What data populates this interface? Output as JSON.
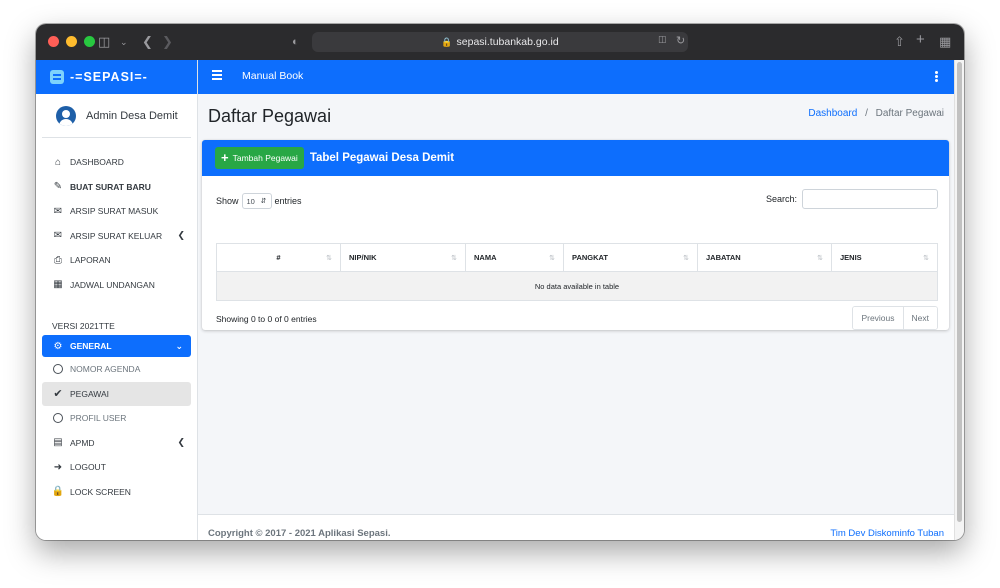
{
  "browser": {
    "url": "sepasi.tubankab.go.id"
  },
  "sidebar": {
    "brand": "-=SEPASI=-",
    "user": "Admin Desa Demit",
    "items": [
      {
        "label": "DASHBOARD",
        "icon": "home-icon",
        "bold": false
      },
      {
        "label": "BUAT SURAT BARU",
        "icon": "edit-icon",
        "bold": true
      },
      {
        "label": "ARSIP SURAT MASUK",
        "icon": "inbox-icon",
        "bold": false
      },
      {
        "label": "ARSIP SURAT KELUAR",
        "icon": "outbox-icon",
        "bold": false
      },
      {
        "label": "LAPORAN",
        "icon": "printer-icon",
        "bold": false
      },
      {
        "label": "JADWAL UNDANGAN",
        "icon": "calendar-icon",
        "bold": false
      }
    ],
    "version_header": "VERSI 2021TTE",
    "general": "GENERAL",
    "sub_items": [
      {
        "label": "NOMOR AGENDA"
      },
      {
        "label": "PEGAWAI"
      },
      {
        "label": "PROFIL USER"
      }
    ],
    "apmd": "APMD",
    "logout": "LOGOUT",
    "lock": "LOCK SCREEN"
  },
  "navbar": {
    "link": "Manual Book"
  },
  "header": {
    "title": "Daftar Pegawai",
    "breadcrumb_home": "Dashboard",
    "breadcrumb_sep": "/",
    "breadcrumb_current": "Daftar Pegawai"
  },
  "card": {
    "add_button": "Tambah Pegawai",
    "title": "Tabel Pegawai Desa Demit"
  },
  "datatable": {
    "show_label": "Show",
    "length_value": "10",
    "entries_label": "entries",
    "search_label": "Search:",
    "search_value": "",
    "columns": [
      "#",
      "NIP/NIK",
      "NAMA",
      "PANGKAT",
      "JABATAN",
      "JENIS"
    ],
    "empty_text": "No data available in table",
    "info": "Showing 0 to 0 of 0 entries",
    "prev": "Previous",
    "next": "Next"
  },
  "footer": {
    "copyright": "Copyright © 2017 - 2021 Aplikasi Sepasi.",
    "credit": "Tim Dev Diskominfo Tuban"
  },
  "colors": {
    "primary": "#0d6efd",
    "success": "#28a745"
  }
}
